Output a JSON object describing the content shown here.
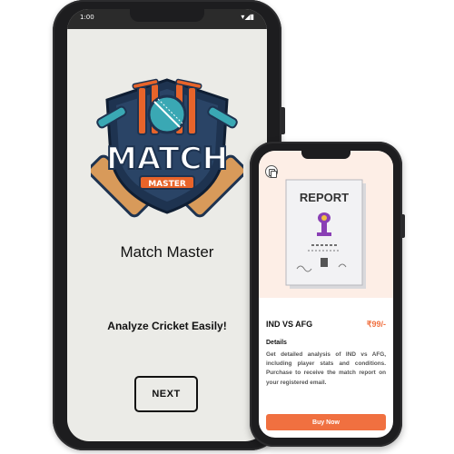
{
  "onboarding": {
    "status_time": "1:00",
    "status_icons": "▾◢▮",
    "logo_text": "MATCH",
    "logo_subtext": "MASTER",
    "app_title": "Match Master",
    "tagline": "Analyze Cricket Easily!",
    "next_label": "NEXT"
  },
  "report": {
    "doc_title": "REPORT",
    "match_name": "IND VS AFG",
    "price": "₹99/-",
    "details_label": "Details",
    "details_text": "Get detailed analysis of IND vs AFG, including player stats and conditions. Purchase to receive the match report on your registered email.",
    "buy_label": "Buy Now"
  },
  "colors": {
    "accent": "#f07040",
    "logo_navy": "#1e3350",
    "logo_orange": "#e8642a",
    "logo_teal": "#3aa8b4",
    "screen_bg": "#ebebe7"
  }
}
